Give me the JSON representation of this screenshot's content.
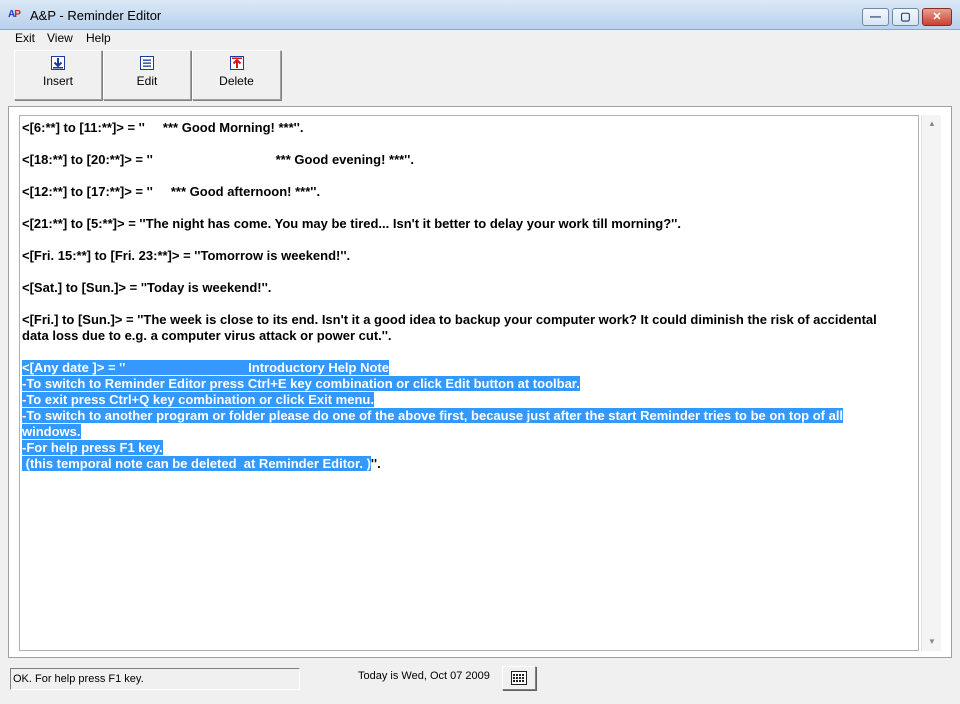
{
  "window": {
    "title": "A&P - Reminder Editor",
    "logo_a": "A",
    "logo_p": "P",
    "min_glyph": "—",
    "max_glyph": "▢",
    "close_glyph": "✕"
  },
  "menu": {
    "exit": "Exit",
    "view": "View",
    "help": "Help"
  },
  "toolbar": {
    "insert": "Insert",
    "edit": "Edit",
    "delete": "Delete"
  },
  "editor": {
    "lines": [
      "<[6:**] to [11:**]> = ''     *** Good Morning! ***''.",
      "<[18:**] to [20:**]> = ''                                  *** Good evening! ***''.",
      "<[12:**] to [17:**]> = ''     *** Good afternoon! ***''.",
      "<[21:**] to [5:**]> = ''The night has come. You may be tired... Isn't it better to delay your work till morning?''.",
      "<[Fri. 15:**] to [Fri. 23:**]> = ''Tomorrow is weekend!''.",
      "<[Sat.] to [Sun.]> = ''Today is weekend!''.",
      "<[Fri.] to [Sun.]> = ''The week is close to its end. Isn't it a good idea to backup your computer work? It could diminish the risk of accidental",
      "data loss due to e.g. a computer virus attack or power cut.''."
    ],
    "selected_lines": [
      "<[Any date ]> = ''                                  Introductory Help Note",
      "-To switch to Reminder Editor press Ctrl+E key combination or click Edit button at toolbar.",
      "-To exit press Ctrl+Q key combination or click Exit menu.",
      "-To switch to another program or folder please do one of the above first, because just after the start Reminder tries to be on top of all",
      "windows.",
      "-For help press F1 key.",
      " (this temporal note can be deleted  at Reminder Editor. )"
    ],
    "trailing": "''."
  },
  "status": {
    "message": "OK. For help press F1 key.",
    "date": "Today is Wed, Oct 07 2009"
  },
  "colors": {
    "selection": "#3399ff"
  }
}
